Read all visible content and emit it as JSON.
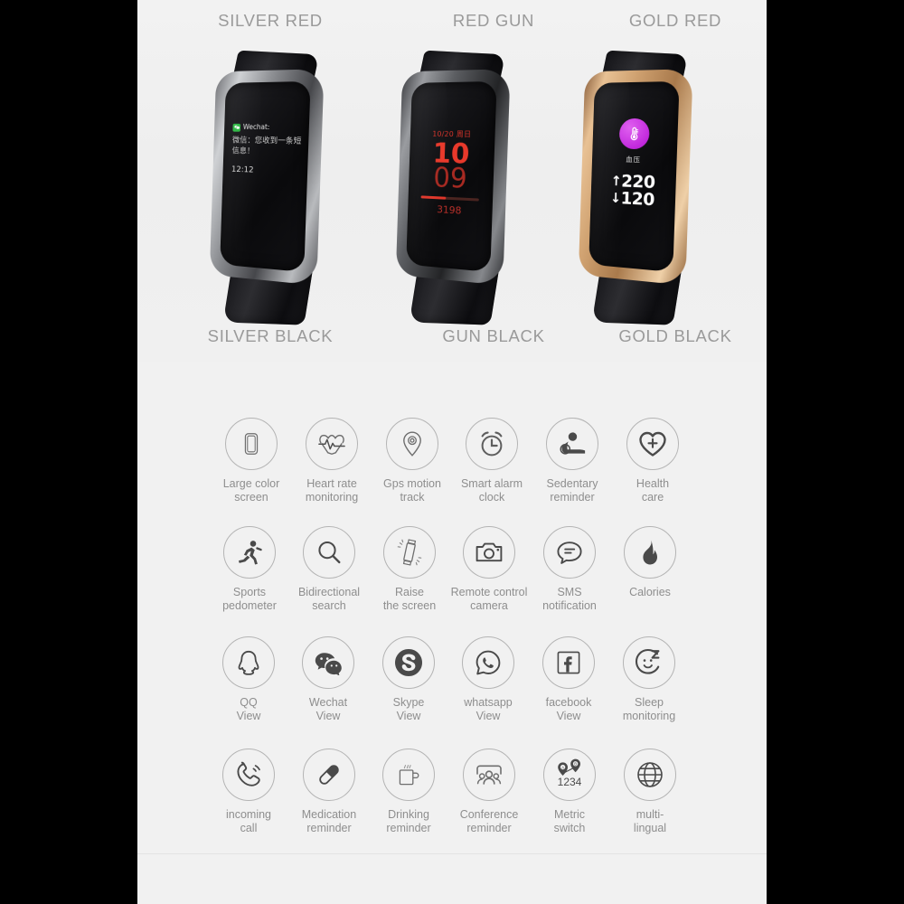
{
  "page": {
    "background_color": "#000000",
    "panel_color": "#f1f1f1"
  },
  "product": {
    "top_labels": [
      "SILVER RED",
      "RED GUN",
      "GOLD RED"
    ],
    "bottom_labels": [
      "SILVER BLACK",
      "GUN BLACK",
      "GOLD BLACK"
    ],
    "watches": [
      {
        "finish": "silver",
        "bezel_color": "#8e9094",
        "screen_type": "notification",
        "screen": {
          "app_name": "Wechat:",
          "message": "微信：您收到一条短信息！",
          "time": "12:12"
        }
      },
      {
        "finish": "gun",
        "bezel_color": "#5c5e62",
        "screen_type": "clock",
        "screen": {
          "date": "10/20 周日",
          "hour": "10",
          "minute": "09",
          "steps": "3198",
          "progress_percent": 44,
          "accent_color": "#e23b2e"
        }
      },
      {
        "finish": "gold",
        "bezel_color": "#d0a271",
        "screen_type": "blood-pressure",
        "screen": {
          "badge_color": "#c229dd",
          "metric_cn": "血压",
          "systolic": "220",
          "diastolic": "120",
          "up_arrow": "↑",
          "down_arrow": "↓"
        }
      }
    ]
  },
  "features": {
    "rows": [
      [
        {
          "icon": "phone-screen-icon",
          "label": "Large color\nscreen"
        },
        {
          "icon": "heart-pulse-icon",
          "label": "Heart rate\nmonitoring"
        },
        {
          "icon": "map-pin-icon",
          "label": "Gps motion\ntrack"
        },
        {
          "icon": "alarm-clock-icon",
          "label": "Smart alarm\nclock"
        },
        {
          "icon": "sedentary-person-icon",
          "label": "Sedentary\nreminder"
        },
        {
          "icon": "heart-plus-icon",
          "label": "Health\ncare"
        }
      ],
      [
        {
          "icon": "running-person-icon",
          "label": "Sports\npedometer"
        },
        {
          "icon": "magnifier-icon",
          "label": "Bidirectional\nsearch"
        },
        {
          "icon": "raise-wrist-icon",
          "label": "Raise\nthe screen"
        },
        {
          "icon": "camera-icon",
          "label": "Remote control\ncamera"
        },
        {
          "icon": "sms-bubble-icon",
          "label": "SMS\nnotification"
        },
        {
          "icon": "flame-icon",
          "label": "Calories"
        }
      ],
      [
        {
          "icon": "qq-penguin-icon",
          "label": "QQ\nView"
        },
        {
          "icon": "wechat-icon",
          "label": "Wechat\nView"
        },
        {
          "icon": "skype-icon",
          "label": "Skype\nView"
        },
        {
          "icon": "whatsapp-icon",
          "label": "whatsapp\nView"
        },
        {
          "icon": "facebook-icon",
          "label": "facebook\nView"
        },
        {
          "icon": "sleep-moon-icon",
          "label": "Sleep\nmonitoring"
        }
      ],
      [
        {
          "icon": "incoming-call-icon",
          "label": "incoming\ncall"
        },
        {
          "icon": "pill-icon",
          "label": "Medication\nreminder"
        },
        {
          "icon": "mug-icon",
          "label": "Drinking\nreminder"
        },
        {
          "icon": "conference-people-icon",
          "label": "Conference\nreminder"
        },
        {
          "icon": "metric-pins-icon",
          "label": "Metric\nswitch",
          "value": "1234"
        },
        {
          "icon": "globe-icon",
          "label": "multi-\nlingual"
        }
      ]
    ]
  }
}
